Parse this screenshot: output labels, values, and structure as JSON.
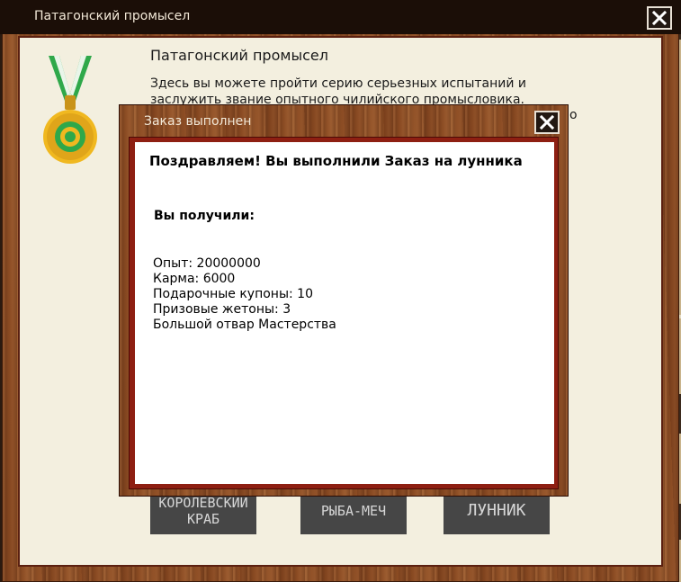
{
  "main_window": {
    "title": "Патагонский промысел",
    "heading": "Патагонский промысел",
    "description": "Здесь вы можете пройти серию серьезных испытаний и заслужить звание опытного чилийского промысловика.",
    "description_overflow": "о",
    "boards": [
      {
        "label": "КОРОЛЕВСКИЙ КРАБ"
      },
      {
        "label": "РЫБА-МЕЧ"
      },
      {
        "label": "ЛУННИК"
      }
    ]
  },
  "dialog": {
    "title": "Заказ выполнен",
    "congrats": "Поздравляем! Вы выполнили Заказ на лунника",
    "received_label": "Вы получили:",
    "rewards": [
      "Опыт: 20000000",
      "Карма: 6000",
      "Подарочные купоны: 10",
      "Призовые жетоны: 3",
      "Большой отвар Мастерства"
    ]
  },
  "icons": {
    "close": "close-icon",
    "medal": "medal-icon"
  },
  "colors": {
    "wood": "#8a4a22",
    "title_bar": "#1b0e07",
    "panel": "#f3efdf",
    "dialog_border": "#8e1f12",
    "board": "#464646",
    "ribbon_green": "#2fa84a",
    "medal_gold": "#e8b322"
  }
}
